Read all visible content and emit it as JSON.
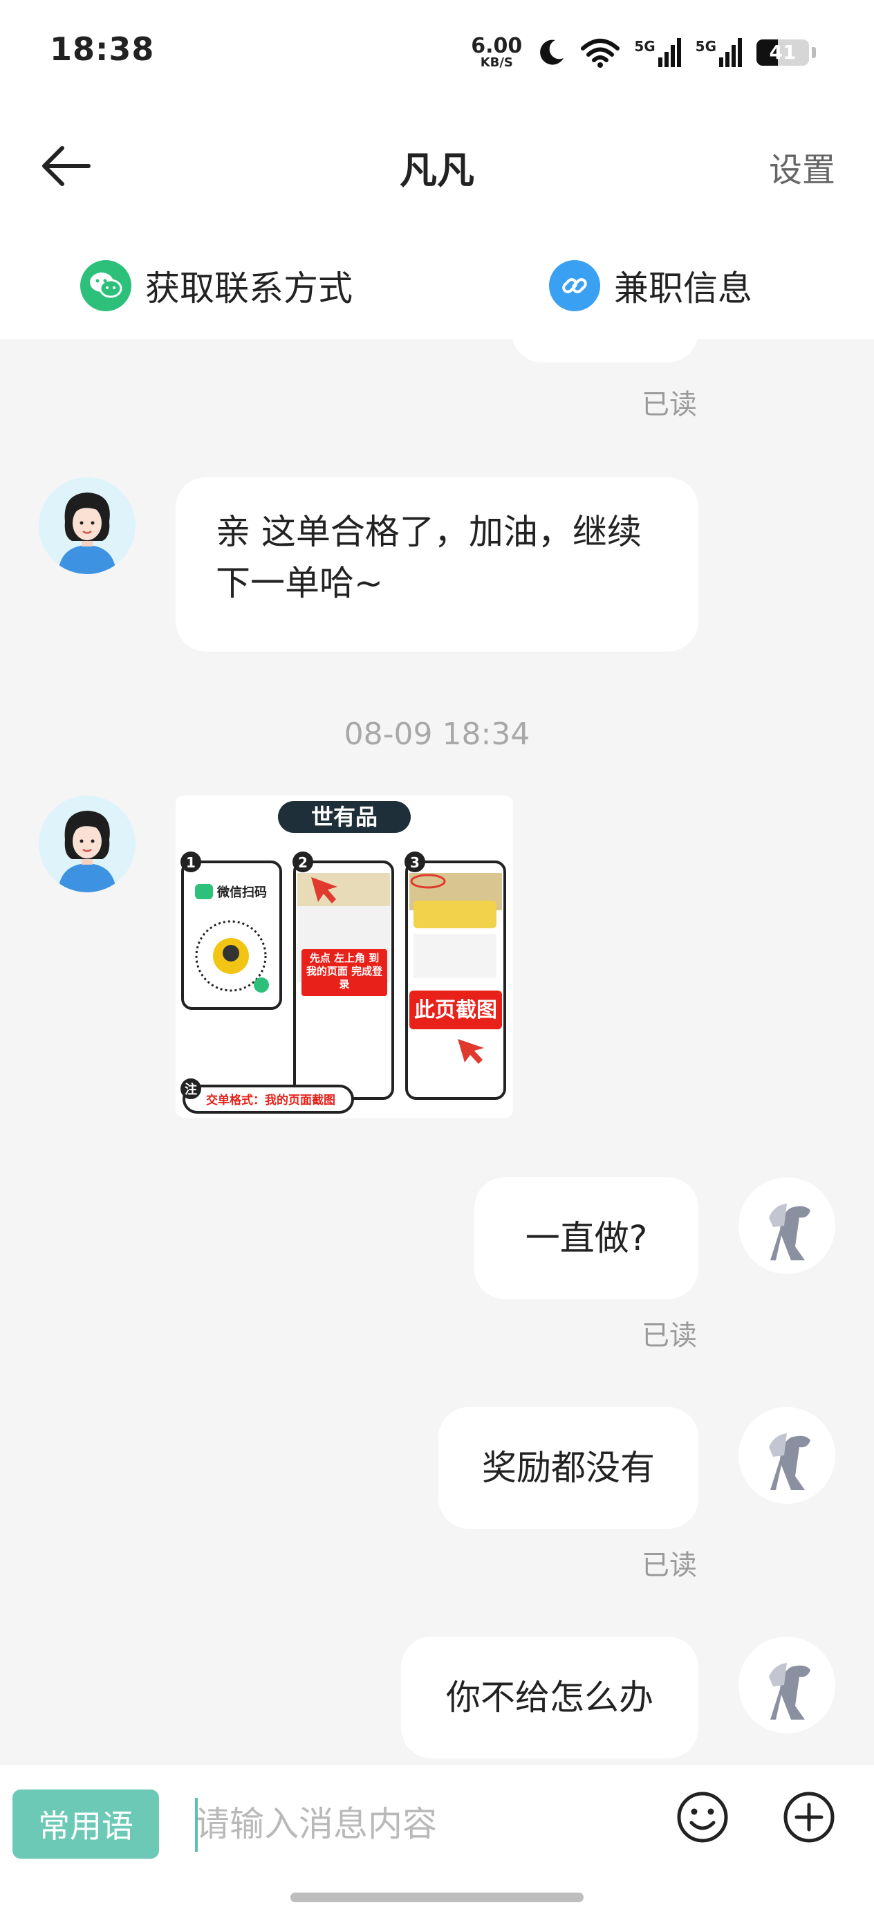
{
  "status_bar": {
    "time": "18:38",
    "net_speed": "6.00",
    "net_speed_unit": "KB/S",
    "network_1": "5G",
    "network_2": "5G",
    "battery": "41"
  },
  "header": {
    "title": "凡凡",
    "settings_label": "设置"
  },
  "quick_links": [
    {
      "label": "获取联系方式",
      "icon": "wechat-icon"
    },
    {
      "label": "兼职信息",
      "icon": "link-icon"
    }
  ],
  "messages": [
    {
      "side": "right",
      "read_label": "已读"
    },
    {
      "side": "left",
      "text": "亲  这单合格了，加油，继续下一单哈~"
    },
    {
      "timestamp": "08-09 18:34"
    },
    {
      "side": "left",
      "type": "image",
      "image": {
        "title": "世有品",
        "steps": [
          "1",
          "2",
          "3"
        ],
        "step1_label": "微信扫码",
        "step2_label": "先点 左上角 到 我的页面 完成登录",
        "step3_label": "此页截图",
        "note_mark": "注",
        "note_text": "交单格式：我的页面截图"
      }
    },
    {
      "side": "right",
      "text": "一直做?",
      "read_label": "已读"
    },
    {
      "side": "right",
      "text": "奖励都没有",
      "read_label": "已读"
    },
    {
      "side": "right",
      "text": "你不给怎么办"
    }
  ],
  "input_bar": {
    "phrases_label": "常用语",
    "placeholder": "请输入消息内容"
  },
  "colors": {
    "accent": "#6cc9b6",
    "wechat_green": "#2cc07b",
    "link_blue": "#3aa0f2",
    "read_gray": "#9b9b9b"
  }
}
